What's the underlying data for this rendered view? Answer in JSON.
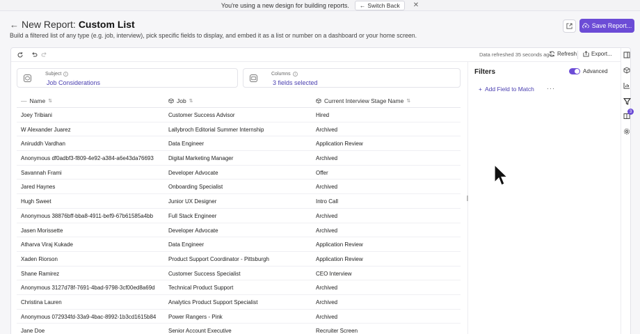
{
  "banner": {
    "message": "You're using a new design for building reports.",
    "switch_label": "Switch Back",
    "close": "✕"
  },
  "header": {
    "back_arrow": "←",
    "prefix": "New Report:",
    "title": "Custom List",
    "subtitle": "Build a filtered list of any type (e.g. job, interview), pick specific fields to display, and embed it as a list or number on a dashboard or your home screen.",
    "save_label": "Save Report..."
  },
  "toolbar": {
    "refreshed_text": "Data refreshed 35 seconds ago",
    "refresh_label": "Refresh",
    "export_label": "Export..."
  },
  "subject": {
    "label": "Subject",
    "value": "Job Considerations"
  },
  "columns": {
    "label": "Columns",
    "value": "3 fields selected"
  },
  "table": {
    "headers": [
      "Name",
      "Job",
      "Current Interview Stage Name"
    ],
    "rows": [
      [
        "Joey Tribiani",
        "Customer Success Advisor",
        "Hired"
      ],
      [
        "W Alexander Juarez",
        "Lallybroch Editorial Summer Internship",
        "Archived"
      ],
      [
        "Aniruddh Vardhan",
        "Data Engineer",
        "Application Review"
      ],
      [
        "Anonymous df0adbf3-f809-4e92-a384-a6e43da76693",
        "Digital Marketing Manager",
        "Archived"
      ],
      [
        "Savannah Frami",
        "Developer Advocate",
        "Offer"
      ],
      [
        "Jared Haynes",
        "Onboarding Specialist",
        "Archived"
      ],
      [
        "Hugh Sweet",
        "Junior UX Designer",
        "Intro Call"
      ],
      [
        "Anonymous 38876bff-bba8-4911-bef9-67b61585a4bb",
        "Full Stack Engineer",
        "Archived"
      ],
      [
        "Jasen Morissette",
        "Developer Advocate",
        "Archived"
      ],
      [
        "Atharva Viraj Kukade",
        "Data Engineer",
        "Application Review"
      ],
      [
        "Xaden Riorson",
        "Product Support Coordinator - Pittsburgh",
        "Application Review"
      ],
      [
        "Shane Ramirez",
        "Customer Success Specialist",
        "CEO Interview"
      ],
      [
        "Anonymous 3127d78f-7691-4bad-9798-3cf00ed8a69d",
        "Technical Product Support",
        "Archived"
      ],
      [
        "Christina Lauren",
        "Analytics Product Support Specialist",
        "Archived"
      ],
      [
        "Anonymous 072934fd-33a9-4bac-8992-1b3cd1615b84",
        "Power Rangers - Pink",
        "Archived"
      ],
      [
        "Jane Doe",
        "Senior Account Executive",
        "Recruiter Screen"
      ]
    ]
  },
  "filters": {
    "title": "Filters",
    "advanced_label": "Advanced",
    "add_field_label": "Add Field to Match",
    "more": "···"
  },
  "rail": {
    "badge_count": "3"
  },
  "colors": {
    "accent": "#6c4cd6",
    "link": "#4a3fb0"
  }
}
